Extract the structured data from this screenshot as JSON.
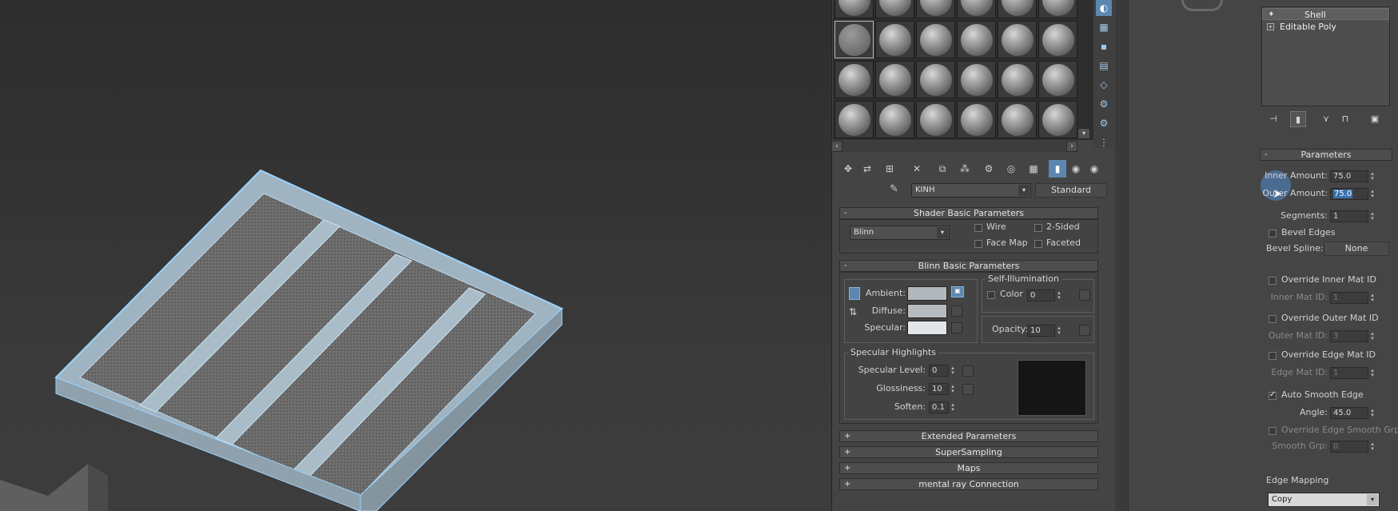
{
  "material_editor": {
    "slot_grid": {
      "rows": 4,
      "cols": 6,
      "active_slot": 6
    },
    "material_name": "KINH",
    "material_type": "Standard",
    "shader_basic": {
      "title": "Shader Basic Parameters",
      "shader": "Blinn",
      "wire_label": "Wire",
      "two_sided_label": "2-Sided",
      "face_map_label": "Face Map",
      "faceted_label": "Faceted"
    },
    "blinn_basic": {
      "title": "Blinn Basic Parameters",
      "ambient_label": "Ambient:",
      "diffuse_label": "Diffuse:",
      "specular_label": "Specular:",
      "self_illum_title": "Self-Illumination",
      "color_label": "Color",
      "color_value": "0",
      "opacity_label": "Opacity:",
      "opacity_value": "10",
      "ambient_color": "#b2b7bb",
      "diffuse_color": "#b6bbbf",
      "specular_color": "#e3e6e8"
    },
    "specular_highlights": {
      "title": "Specular Highlights",
      "level_label": "Specular Level:",
      "level_value": "0",
      "gloss_label": "Glossiness:",
      "gloss_value": "10",
      "soften_label": "Soften:",
      "soften_value": "0.1"
    },
    "collapsed_rollouts": [
      "Extended Parameters",
      "SuperSampling",
      "Maps",
      "mental ray Connection"
    ]
  },
  "command_panel": {
    "stack": [
      "Shell",
      "Editable Poly"
    ],
    "parameters_title": "Parameters",
    "inner_amount_label": "Inner Amount:",
    "inner_amount_value": "75.0",
    "outer_amount_label": "Outer Amount:",
    "outer_amount_value": "75.0",
    "segments_label": "Segments:",
    "segments_value": "1",
    "bevel_edges_label": "Bevel Edges",
    "bevel_spline_label": "Bevel Spline:",
    "bevel_spline_button": "None",
    "override_inner_label": "Override Inner Mat ID",
    "inner_mat_label": "Inner Mat ID:",
    "inner_mat_value": "1",
    "override_outer_label": "Override Outer Mat ID",
    "outer_mat_label": "Outer Mat ID:",
    "outer_mat_value": "3",
    "override_edge_label": "Override Edge Mat ID",
    "edge_mat_label": "Edge Mat ID:",
    "edge_mat_value": "1",
    "auto_smooth_label": "Auto Smooth Edge",
    "angle_label": "Angle:",
    "angle_value": "45.0",
    "override_smooth_label": "Override Edge Smooth Grp",
    "smooth_grp_label": "Smooth Grp:",
    "smooth_grp_value": "0",
    "edge_mapping_label": "Edge Mapping",
    "edge_mapping_value": "Copy"
  },
  "icons": {
    "collapse": "-",
    "expand": "+",
    "dropdown": "▾",
    "left": "‹",
    "right": "›",
    "down": "▾",
    "checkmark": "✓"
  }
}
